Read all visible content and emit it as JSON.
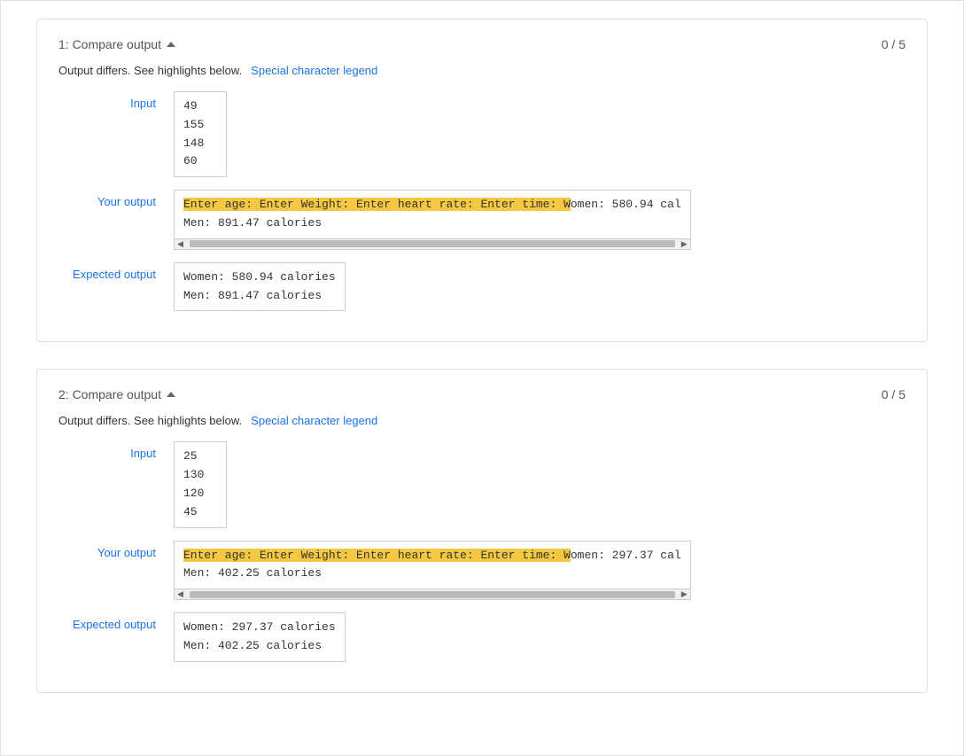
{
  "sections": [
    {
      "id": "section-1",
      "title": "1: Compare output",
      "score": "0 / 5",
      "differs_text": "Output differs. See highlights below.",
      "special_char_legend": "Special character legend",
      "input_label": "Input",
      "your_output_label": "Your output",
      "expected_output_label": "Expected output",
      "input_lines": [
        "49",
        "155",
        "148",
        "60"
      ],
      "your_output_highlighted": "Enter age: Enter Weight: Enter heart rate: Enter time: W",
      "your_output_normal": "omen: 580.94 cal",
      "your_output_line2": "Men: 891.47 calories",
      "expected_line1": "Women: 580.94 calories",
      "expected_line2": "Men: 891.47 calories"
    },
    {
      "id": "section-2",
      "title": "2: Compare output",
      "score": "0 / 5",
      "differs_text": "Output differs. See highlights below.",
      "special_char_legend": "Special character legend",
      "input_label": "Input",
      "your_output_label": "Your output",
      "expected_output_label": "Expected output",
      "input_lines": [
        "25",
        "130",
        "120",
        "45"
      ],
      "your_output_highlighted": "Enter age: Enter Weight: Enter heart rate: Enter time: W",
      "your_output_normal": "omen: 297.37 cal",
      "your_output_line2": "Men: 402.25 calories",
      "expected_line1": "Women: 297.37 calories",
      "expected_line2": "Men: 402.25 calories"
    }
  ]
}
